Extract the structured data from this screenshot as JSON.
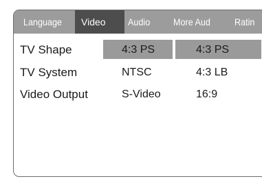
{
  "tabs": [
    {
      "label": "Language",
      "active": false
    },
    {
      "label": "Video",
      "active": true
    },
    {
      "label": "Audio",
      "active": false
    },
    {
      "label": "More Aud",
      "active": false
    },
    {
      "label": "Ratin",
      "active": false
    }
  ],
  "settings": [
    {
      "label": "TV Shape",
      "current": "4:3 PS"
    },
    {
      "label": "TV System",
      "current": "NTSC"
    },
    {
      "label": "Video Output",
      "current": "S-Video"
    }
  ],
  "options": [
    "4:3 PS",
    "4:3 LB",
    "16:9"
  ],
  "colors": {
    "tab_bar": "#9c9c9c",
    "tab_active": "#4d4d4d",
    "highlight": "#9a9a9a",
    "border": "#6a6a6a"
  }
}
